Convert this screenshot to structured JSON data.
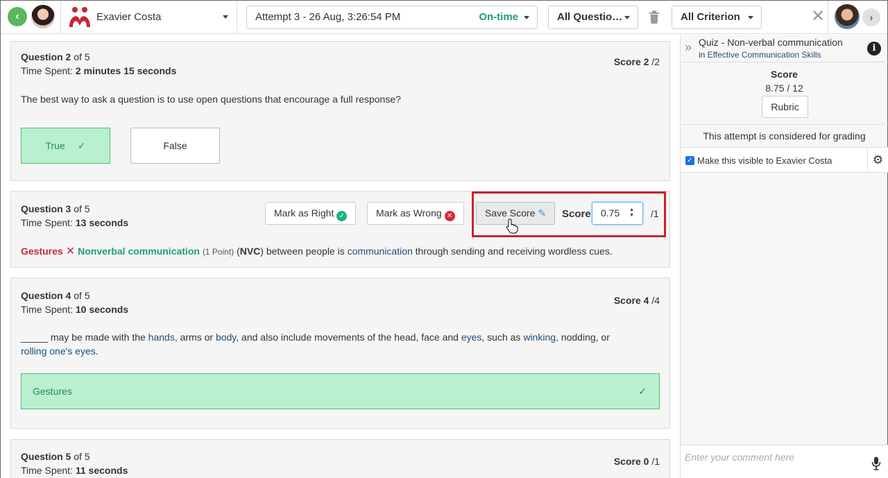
{
  "header": {
    "student_name": "Exavier Costa",
    "attempt_label": "Attempt 3 - 26 Aug, 3:26:54 PM",
    "attempt_status": "On-time",
    "questions_filter": "All Questio…",
    "criterion_filter": "All Criterion"
  },
  "questions": {
    "q2": {
      "number": "Question 2",
      "of": "of 5",
      "time_label": "Time Spent:",
      "time_value": "2 minutes 15 seconds",
      "score_label": "Score 2",
      "score_max": "/2",
      "text": "The best way to ask a question is to use open questions that encourage a full response?",
      "option_true": "True",
      "option_false": "False"
    },
    "q3": {
      "number": "Question 3",
      "of": "of 5",
      "time_label": "Time Spent:",
      "time_value": "13 seconds",
      "mark_right": "Mark as Right",
      "mark_wrong": "Mark as Wrong",
      "save_score": "Save Score",
      "score_label": "Score",
      "score_value": "0.75",
      "score_max": "/1",
      "student_answer": "Gestures",
      "correct_answer": "Nonverbal communication",
      "points": "(1 Point)",
      "text_open": "(",
      "text_abbr": "NVC",
      "text_between": ") between people is",
      "text_link": "communication",
      "text_end": "through sending and receiving wordless cues."
    },
    "q4": {
      "number": "Question 4",
      "of": "of 5",
      "time_label": "Time Spent:",
      "time_value": "10 seconds",
      "score_label": "Score 4",
      "score_max": "/4",
      "t1": "_____ may be made with the",
      "t2": "hands",
      "t3": ", arms or",
      "t4": "body",
      "t5": ", and also include movements of the head, face and",
      "t6": "eyes",
      "t7": ", such as",
      "t8": "winking",
      "t9": ", nodding, or",
      "t10": "rolling one's eyes",
      "t11": ".",
      "answer": "Gestures"
    },
    "q5": {
      "number": "Question 5",
      "of": "of 5",
      "time_label": "Time Spent:",
      "time_value": "11 seconds",
      "score_label": "Score 0",
      "score_max": "/1"
    }
  },
  "panel": {
    "quiz_title": "Quiz - Non-verbal communication",
    "in_label": "in",
    "course": "Effective Communication Skills",
    "score_title": "Score",
    "score_value": "8.75 / 12",
    "rubric_label": "Rubric",
    "grading_note": "This attempt is considered for grading",
    "visible_label": "Make this visible to Exavier Costa",
    "comment_placeholder": "Enter your comment here"
  },
  "colors": {
    "accent_green": "#1e9e7a",
    "correct_bg": "#b9f0cd",
    "wrong_red": "#c7253a",
    "highlight_box": "#c8242e"
  }
}
